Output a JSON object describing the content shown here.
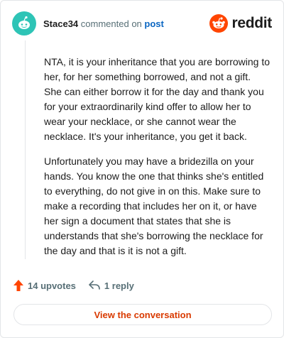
{
  "header": {
    "username": "Stace34",
    "action_text": "commented on",
    "post_link": "post",
    "brand": "reddit"
  },
  "comment": {
    "paragraphs": [
      "NTA, it is your inheritance that you are borrowing to her, for her something borrowed, and not a gift. She can either borrow it for the day and thank you for your extraordinarily kind offer to allow her to wear your necklace, or she cannot wear the necklace. It's your inheritance, you get it back.",
      "Unfortunately you may have a bridezilla on your hands. You know the one that thinks she's entitled to everything, do not give in on this. Make sure to make a recording that includes her on it, or have her sign a document that states that she is understands that she's borrowing the necklace for the day and that is it is not a gift."
    ]
  },
  "actions": {
    "upvotes": "14 upvotes",
    "replies": "1 reply"
  },
  "cta": {
    "label": "View the conversation"
  },
  "colors": {
    "avatar": "#2ec4b6",
    "reddit_orange": "#ff4500",
    "link_blue": "#0a66c2",
    "cta_text": "#d93a00"
  },
  "icons": {
    "avatar": "snoo-avatar-icon",
    "brand": "reddit-logo-icon",
    "upvote": "upvote-arrow-icon",
    "reply": "reply-arrow-icon"
  }
}
